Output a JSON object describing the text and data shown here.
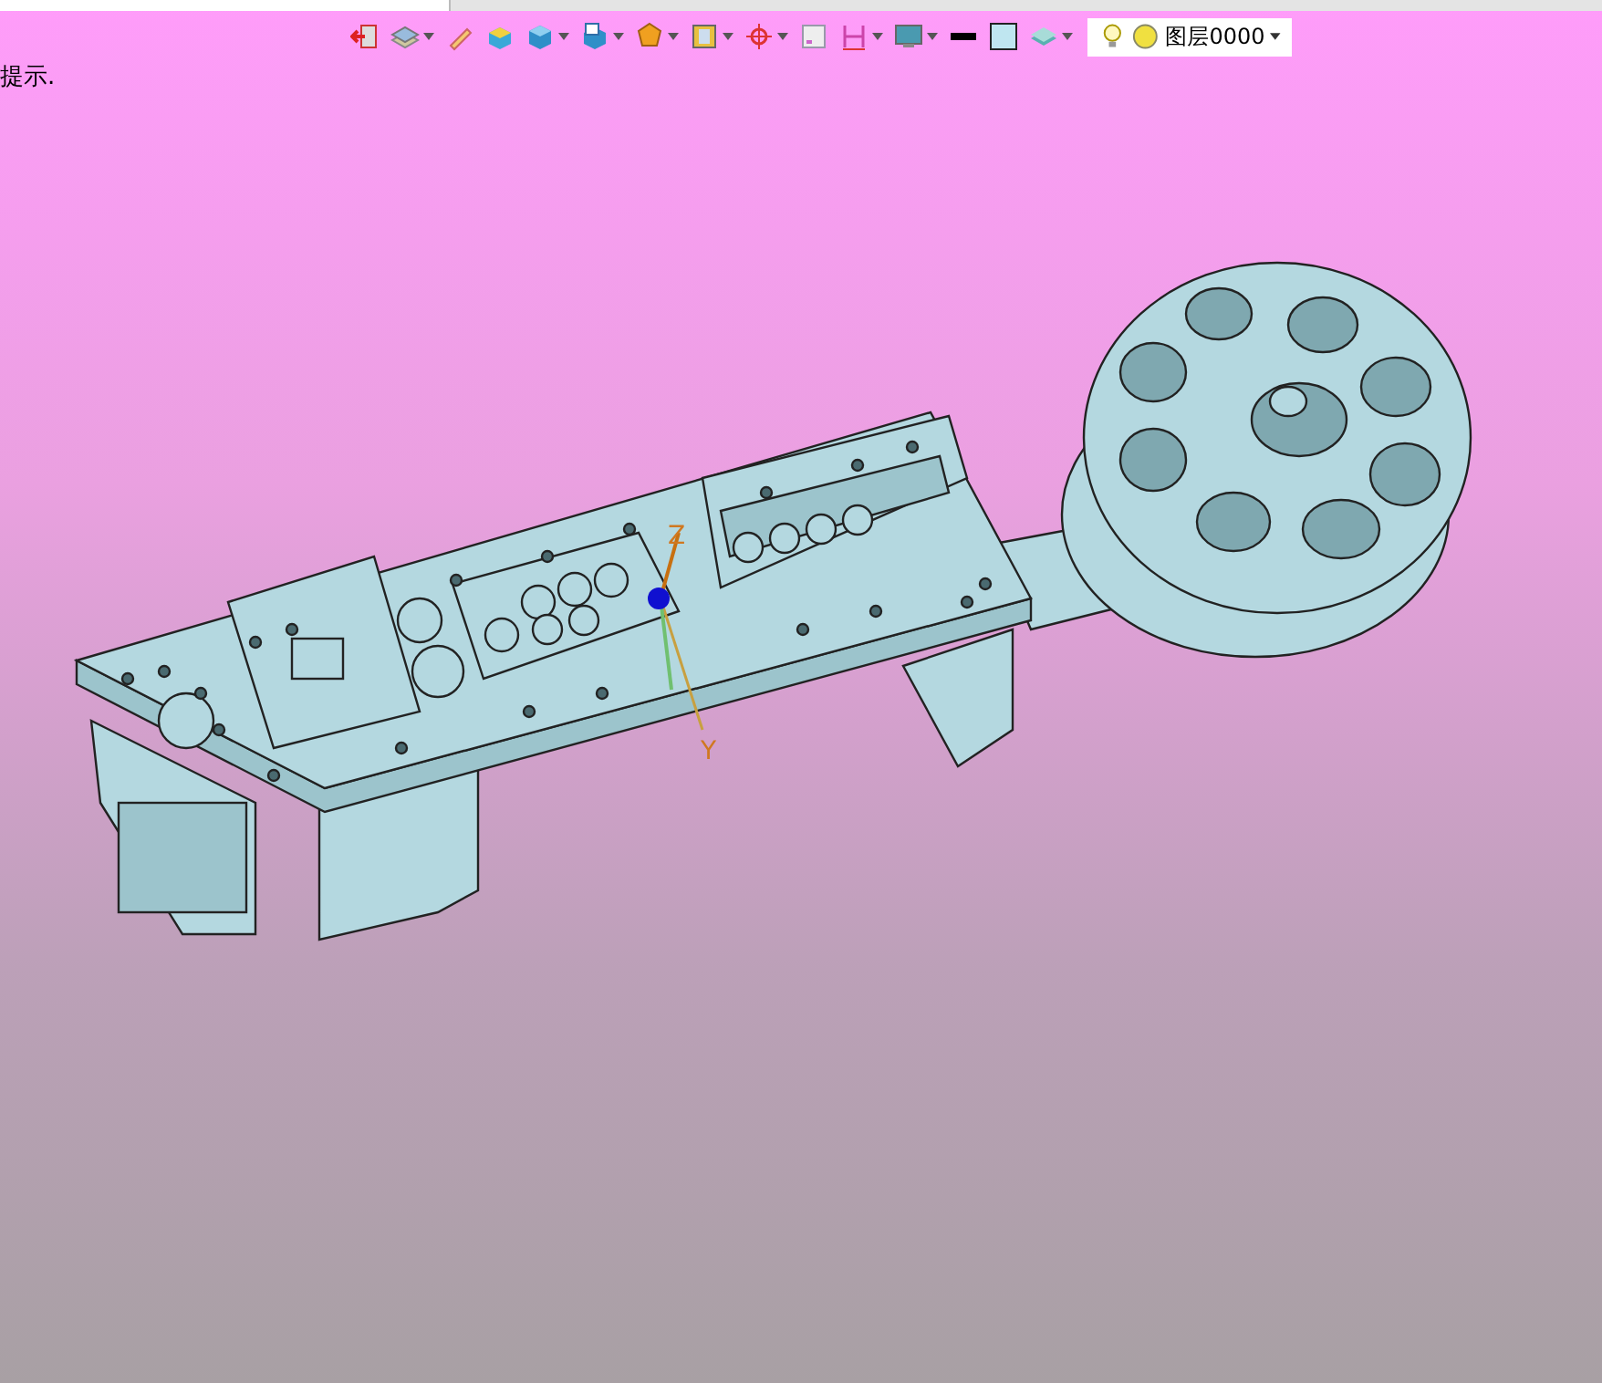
{
  "toolbar": [
    {
      "kind": "exit",
      "dropdown": false
    },
    {
      "kind": "layers",
      "dropdown": true
    },
    {
      "kind": "pencil",
      "dropdown": false
    },
    {
      "kind": "box",
      "dropdown": false
    },
    {
      "kind": "cube",
      "dropdown": true
    },
    {
      "kind": "cube-window",
      "dropdown": true
    },
    {
      "kind": "polygon",
      "dropdown": true
    },
    {
      "kind": "frame",
      "dropdown": true
    },
    {
      "kind": "target",
      "dropdown": true
    },
    {
      "kind": "square",
      "dropdown": false
    },
    {
      "kind": "dimension",
      "dropdown": true
    },
    {
      "kind": "screen",
      "dropdown": true
    },
    {
      "kind": "line",
      "dropdown": false
    },
    {
      "kind": "fill",
      "dropdown": false
    },
    {
      "kind": "plate",
      "dropdown": true
    }
  ],
  "layer_combo": {
    "value": "图层0000"
  },
  "hint": "提示.",
  "axes": [
    {
      "label": "Z"
    },
    {
      "label": "Y"
    }
  ]
}
